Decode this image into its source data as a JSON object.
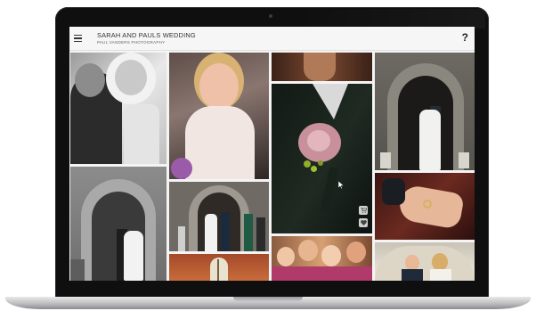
{
  "header": {
    "title": "SARAH AND PAULS WEDDING",
    "subtitle": "PAUL VANDERS PHOTOGRAPHY",
    "help_label": "?"
  },
  "icons": {
    "menu": "hamburger-menu-icon",
    "cart": "shopping-cart-icon",
    "favorite": "heart-icon",
    "pointer": "mouse-cursor-icon"
  },
  "gallery": {
    "photos": [
      "couple-portrait-bw",
      "bride-smiling-bw",
      "ceremony-detail",
      "buttonhole-rose",
      "couple-church-door",
      "church-doorway-couple",
      "church-entrance-party",
      "wedding-rings-hand",
      "guests-crowd",
      "church-window",
      "couple-in-car"
    ]
  }
}
